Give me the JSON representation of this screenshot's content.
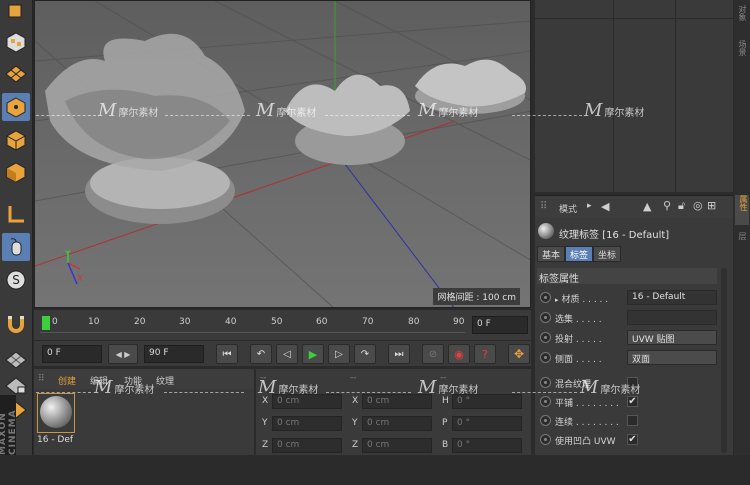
{
  "viewport": {
    "grid_spacing_label": "网格间距 : 100 cm"
  },
  "timeline": {
    "ticks": [
      "0",
      "10",
      "20",
      "30",
      "40",
      "50",
      "60",
      "70",
      "80",
      "90"
    ],
    "current_frame": "0 F"
  },
  "transport": {
    "start_frame": "0 F",
    "end_frame": "90 F"
  },
  "material_panel": {
    "menu": [
      "创建",
      "编辑",
      "功能",
      "纹理"
    ],
    "material_name": "16 - Def"
  },
  "coords": {
    "header": [
      "--",
      "--",
      "--"
    ],
    "rows": [
      {
        "a_label": "X",
        "a_val": "0 cm",
        "b_label": "X",
        "b_val": "0 cm",
        "c_label": "H",
        "c_val": "0 °"
      },
      {
        "a_label": "Y",
        "a_val": "0 cm",
        "b_label": "Y",
        "b_val": "0 cm",
        "c_label": "P",
        "c_val": "0 °"
      },
      {
        "a_label": "Z",
        "a_val": "0 cm",
        "b_label": "Z",
        "b_val": "0 cm",
        "c_label": "B",
        "c_val": "0 °"
      }
    ]
  },
  "attributes": {
    "mode_label": "模式",
    "tag_title": "纹理标签 [16 - Default]",
    "tabs": [
      "基本",
      "标签",
      "坐标"
    ],
    "active_tab": "标签",
    "section_title": "标签属性",
    "rows": [
      {
        "label": "材质",
        "dots": " . . . . .",
        "value": "16 - Default",
        "type": "field"
      },
      {
        "label": "选集",
        "dots": " . . . . .",
        "value": "",
        "type": "field"
      },
      {
        "label": "投射",
        "dots": " . . . . .",
        "value": "UVW 贴图",
        "type": "field"
      },
      {
        "label": "侧面",
        "dots": " . . . . .",
        "value": "双面",
        "type": "field"
      },
      {
        "label": "混合纹理",
        "dots": "",
        "value": "",
        "type": "check"
      },
      {
        "label": "平铺",
        "dots": " . . . . . . . .",
        "value": "✔",
        "type": "check"
      },
      {
        "label": "连续",
        "dots": " . . . . . . . .",
        "value": "",
        "type": "check"
      },
      {
        "label": "使用凹凸 UVW",
        "dots": "",
        "value": "✔",
        "type": "check"
      }
    ]
  },
  "right_side_tabs": [
    "对象",
    "场景",
    "属性",
    "层"
  ],
  "watermark": {
    "text": "摩尔素材",
    "logo": "M"
  },
  "colors": {
    "selection_blue": "#5a7fb5",
    "accent_orange": "#e8a33a",
    "timeline_green": "#3ccf3c"
  }
}
